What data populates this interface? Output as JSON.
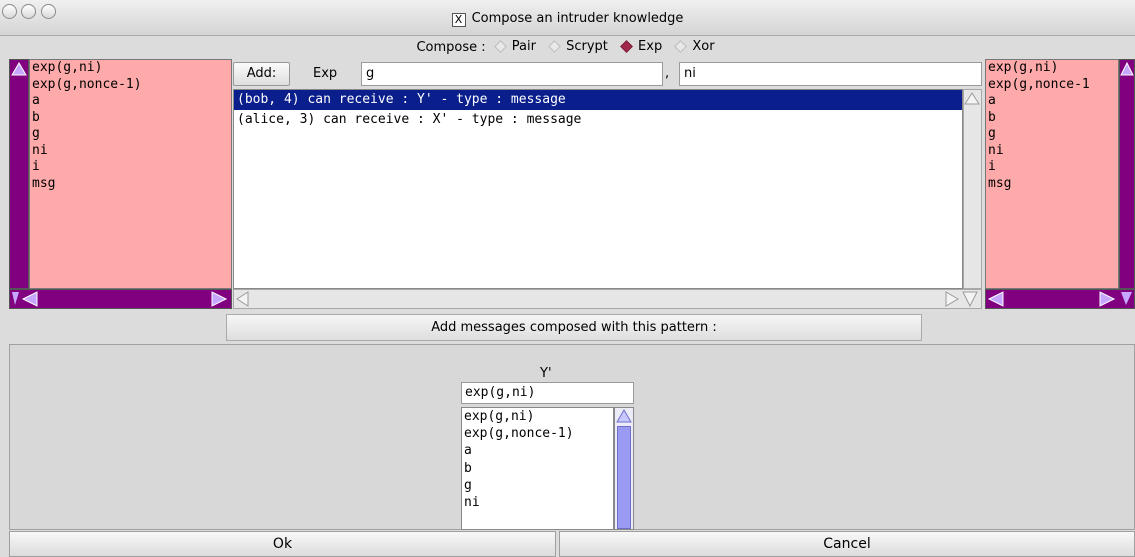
{
  "window": {
    "title": "Compose an intruder knowledge"
  },
  "compose": {
    "label": "Compose :",
    "options": [
      {
        "label": "Pair",
        "selected": false
      },
      {
        "label": "Scrypt",
        "selected": false
      },
      {
        "label": "Exp",
        "selected": true
      },
      {
        "label": "Xor",
        "selected": false
      }
    ]
  },
  "left_list": {
    "items": [
      "exp(g,ni)",
      "exp(g,nonce-1)",
      "a",
      "b",
      "g",
      "ni",
      "i",
      "msg"
    ]
  },
  "right_list": {
    "items": [
      "exp(g,ni)",
      "exp(g,nonce-1",
      "a",
      "b",
      "g",
      "ni",
      "i",
      "msg"
    ]
  },
  "center": {
    "add_label": "Add:",
    "op_label": "Exp",
    "arg1_value": "g",
    "separator": ",",
    "arg2_value": "ni",
    "messages": [
      {
        "text": "(bob, 4) can receive : Y' - type : message",
        "selected": true
      },
      {
        "text": "(alice, 3) can receive : X' - type : message",
        "selected": false
      }
    ],
    "pattern_button": "Add messages composed with this pattern :"
  },
  "lower": {
    "variable_label": "Y'",
    "value": "exp(g,ni)",
    "options": [
      "exp(g,ni)",
      "exp(g,nonce-1)",
      "a",
      "b",
      "g",
      "ni"
    ]
  },
  "buttons": {
    "ok": "Ok",
    "cancel": "Cancel"
  },
  "colors": {
    "list_bg": "#ffaaaa",
    "scroll_purple": "#800080",
    "selection": "#0a1e8c",
    "radio_selected": "#a0284a"
  }
}
